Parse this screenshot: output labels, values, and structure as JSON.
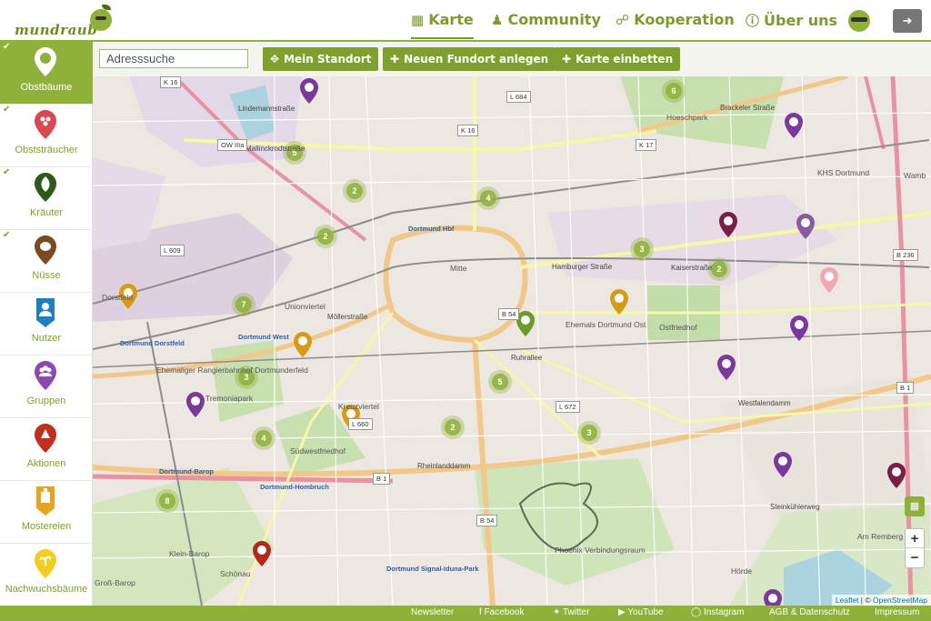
{
  "brand": {
    "name": "mundraub"
  },
  "nav": [
    {
      "label": "Karte",
      "icon": "map-icon"
    },
    {
      "label": "Community",
      "icon": "users-icon"
    },
    {
      "label": "Kooperation",
      "icon": "handshake-icon"
    },
    {
      "label": "Über uns",
      "icon": "info-icon"
    }
  ],
  "toolbar": {
    "search_placeholder": "Adresssuche",
    "buttons": [
      {
        "label": "Mein Standort",
        "icon": "crosshair-icon"
      },
      {
        "label": "Neuen Fundort anlegen",
        "icon": "plus-icon"
      },
      {
        "label": "Karte einbetten",
        "icon": "plus-icon"
      }
    ]
  },
  "sidebar": {
    "items": [
      {
        "label": "Obstbäume",
        "checked": true,
        "active": true,
        "color": "#ffffff",
        "icon": "apple-tree-icon"
      },
      {
        "label": "Obststräucher",
        "checked": true,
        "active": false,
        "color": "#d9474f",
        "icon": "berry-bush-icon"
      },
      {
        "label": "Kräuter",
        "checked": true,
        "active": false,
        "color": "#2d5a1a",
        "icon": "herb-leaf-icon"
      },
      {
        "label": "Nüsse",
        "checked": true,
        "active": false,
        "color": "#7a4a22",
        "icon": "nut-icon"
      },
      {
        "label": "Nutzer",
        "checked": false,
        "active": false,
        "color": "#1e7fc0",
        "icon": "user-icon"
      },
      {
        "label": "Gruppen",
        "checked": false,
        "active": false,
        "color": "#8a4ab0",
        "icon": "group-icon"
      },
      {
        "label": "Aktionen",
        "checked": false,
        "active": false,
        "color": "#c0301e",
        "icon": "action-icon"
      },
      {
        "label": "Mostereien",
        "checked": false,
        "active": false,
        "color": "#e6a51e",
        "icon": "press-icon"
      },
      {
        "label": "Nachwuchsbäume",
        "checked": false,
        "active": false,
        "color": "#f0cf20",
        "icon": "sapling-icon"
      }
    ]
  },
  "map": {
    "clusters": [
      "6",
      "5",
      "2",
      "4",
      "2",
      "3",
      "2",
      "7",
      "3",
      "4",
      "2",
      "5",
      "3",
      "8"
    ],
    "labels": {
      "districts": [
        "Mitte",
        "Unionviertel",
        "Ostfriedhof",
        "Ehemals Dortmund Ost",
        "Südwestfriedhof",
        "Kreuzviertel",
        "Hoeschpark",
        "Tremoniapark",
        "Dorstfeld",
        "Wamb",
        "Am Remberg",
        "Hörde",
        "Schönau",
        "Groß-Barop",
        "Klein-Barop",
        "KHS Dortmund",
        "Phoenix Verbindungsraum",
        "Ehemaliger Rangierbahnhof Dortmunderfeld"
      ],
      "stations": [
        "Dortmund Hbf",
        "Dortmund West",
        "Dortmund Dorstfeld",
        "Dortmund-Barop",
        "Dortmund-Hombruch",
        "Dortmund Signal-Iduna-Park"
      ],
      "streets": [
        "Mallinckrodtstraße",
        "Brackeler Straße",
        "Hamburger Straße",
        "Kaiserstraße",
        "Westfalendamm",
        "Rheinlanddamm",
        "Steinkühlerweg",
        "Ruhrallee",
        "Möllerstraße",
        "Lindemannstraße"
      ],
      "roads": [
        "OW IIIa",
        "K 16",
        "L 684",
        "K 17",
        "L 609",
        "B 236",
        "B 54",
        "L 672",
        "B 1",
        "L 660",
        "B 1",
        "B 54",
        "K 16"
      ]
    },
    "attribution": {
      "leaflet": "Leaflet",
      "separator": " | © ",
      "osm": "OpenStreetMap"
    },
    "zoom": {
      "in": "+",
      "out": "−"
    }
  },
  "footer": {
    "links": [
      {
        "label": "Newsletter",
        "icon": ""
      },
      {
        "label": "Facebook",
        "icon": "facebook-icon"
      },
      {
        "label": "Twitter",
        "icon": "twitter-icon"
      },
      {
        "label": "YouTube",
        "icon": "youtube-icon"
      },
      {
        "label": "Instagram",
        "icon": "instagram-icon"
      },
      {
        "label": "AGB & Datenschutz",
        "icon": ""
      },
      {
        "label": "Impressum",
        "icon": ""
      }
    ]
  },
  "colors": {
    "brand_green": "#8fb03a",
    "dark_green": "#7da12c",
    "purple": "#7b3a9b",
    "orange": "#d79b1a",
    "red": "#b5261e",
    "light_green": "#8fb03a"
  }
}
